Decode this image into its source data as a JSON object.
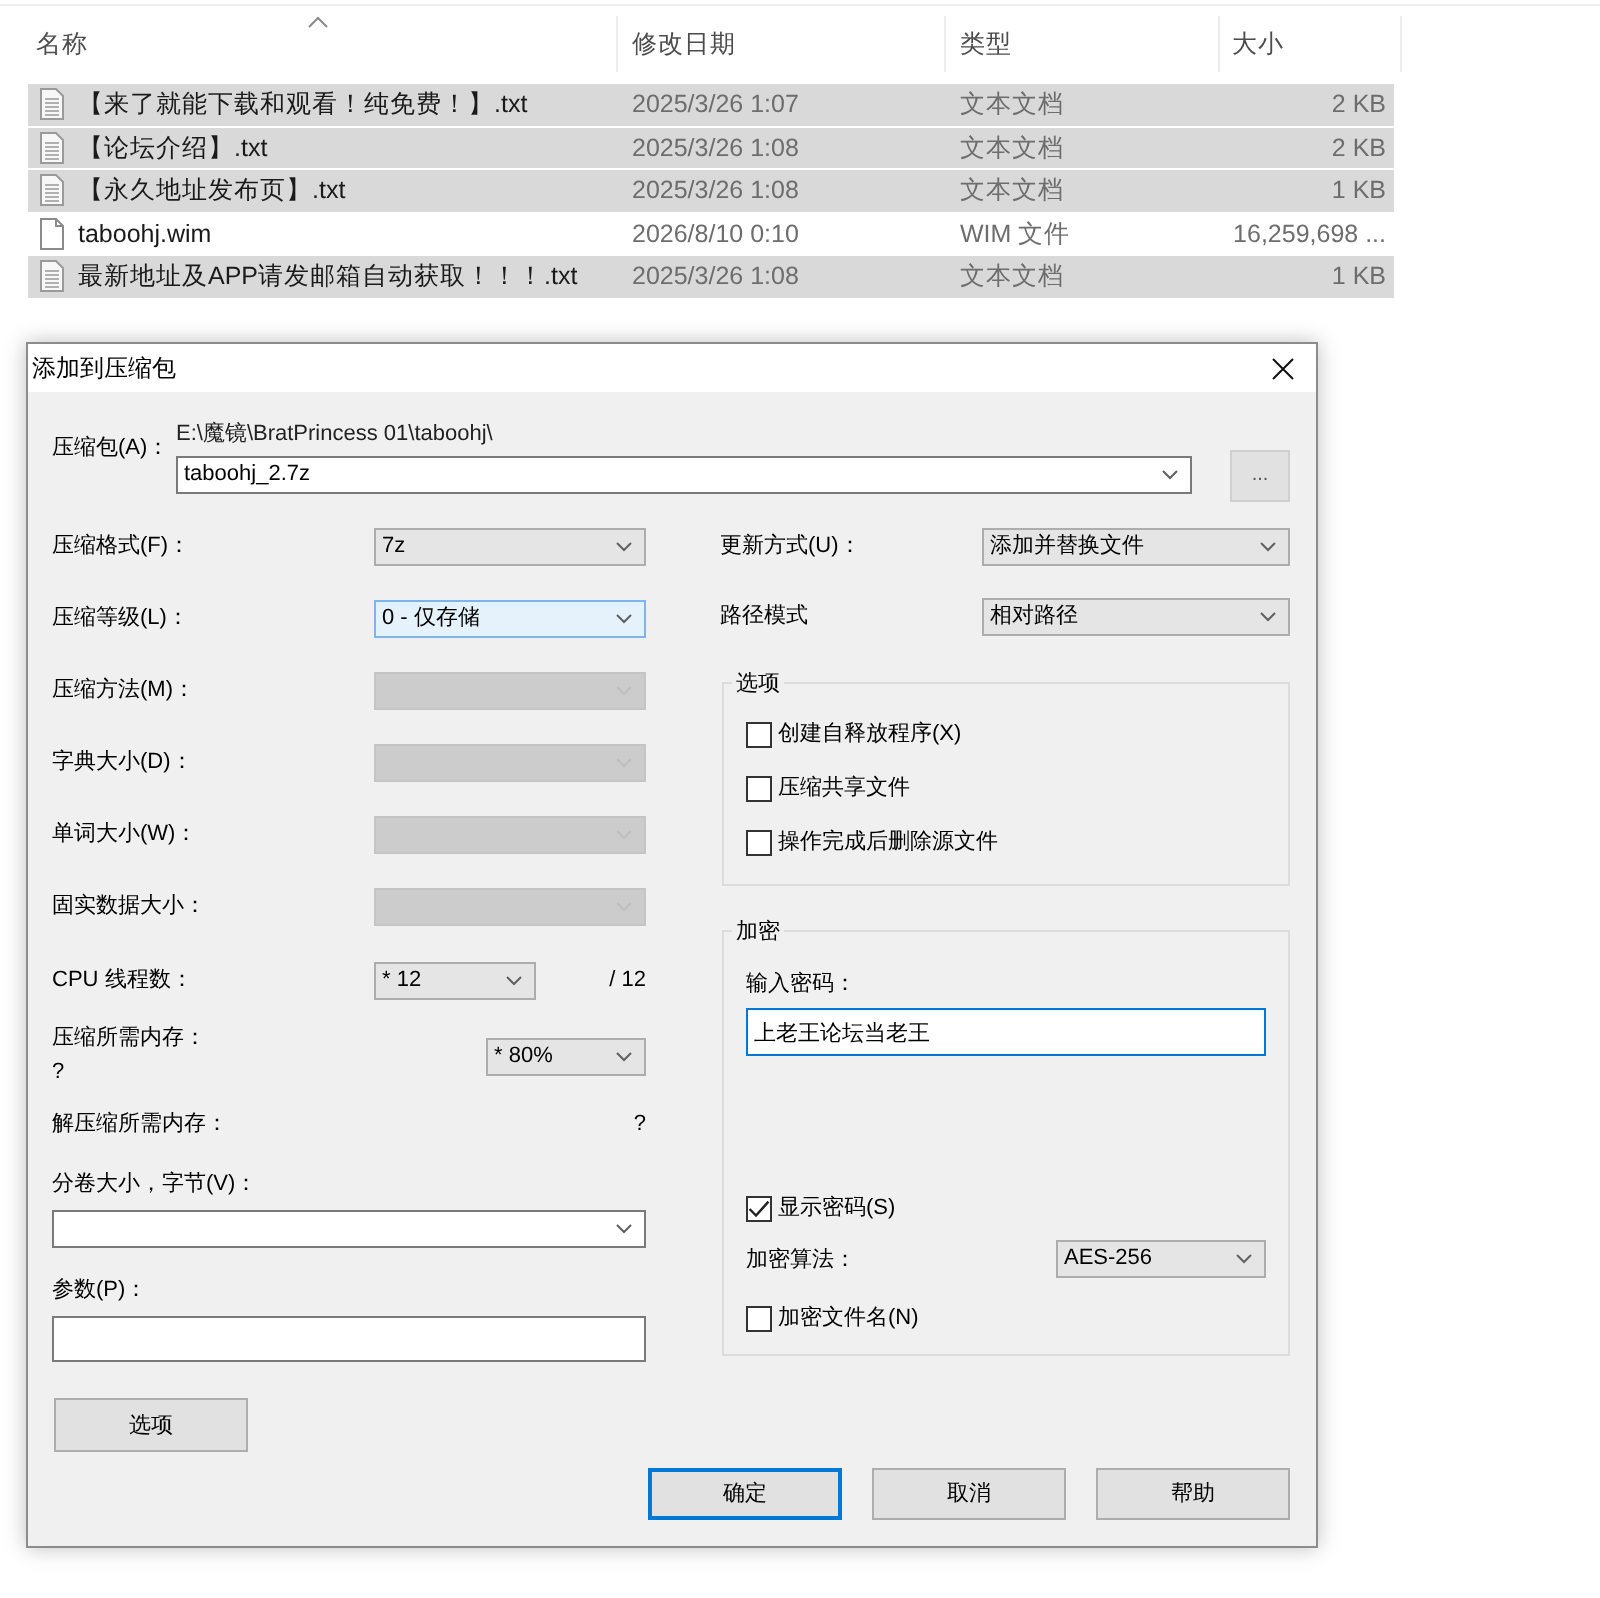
{
  "explorer": {
    "columns": [
      {
        "label": "名称",
        "sorted": true
      },
      {
        "label": "修改日期",
        "sorted": false
      },
      {
        "label": "类型",
        "sorted": false
      },
      {
        "label": "大小",
        "sorted": false
      }
    ],
    "files": [
      {
        "name": "【来了就能下载和观看！纯免费！】.txt",
        "modified": "2025/3/26 1:07",
        "type": "文本文档",
        "size": "2 KB",
        "kind": "text",
        "selected": true
      },
      {
        "name": "【论坛介绍】.txt",
        "modified": "2025/3/26 1:08",
        "type": "文本文档",
        "size": "2 KB",
        "kind": "text",
        "selected": true
      },
      {
        "name": "【永久地址发布页】.txt",
        "modified": "2025/3/26 1:08",
        "type": "文本文档",
        "size": "1 KB",
        "kind": "text",
        "selected": true
      },
      {
        "name": "taboohj.wim",
        "modified": "2026/8/10 0:10",
        "type": "WIM 文件",
        "size": "16,259,698 ...",
        "kind": "blank",
        "selected": false
      },
      {
        "name": "最新地址及APP请发邮箱自动获取！！！.txt",
        "modified": "2025/3/26 1:08",
        "type": "文本文档",
        "size": "1 KB",
        "kind": "text",
        "selected": true
      }
    ]
  },
  "dialog": {
    "title": "添加到压缩包",
    "archive": {
      "label": "压缩包(A)：",
      "path": "E:\\魔镜\\BratPrincess 01\\taboohj\\",
      "value": "taboohj_2.7z",
      "browse": "..."
    },
    "combos": [
      {
        "label": "压缩格式(F)：",
        "value": "7z",
        "disabled": false,
        "hovered": false
      },
      {
        "label": "压缩等级(L)：",
        "value": "0 - 仅存储",
        "disabled": false,
        "hovered": true
      },
      {
        "label": "压缩方法(M)：",
        "disabled": true,
        "hovered": false
      },
      {
        "label": "字典大小(D)：",
        "disabled": true,
        "hovered": false
      },
      {
        "label": "单词大小(W)：",
        "disabled": true,
        "hovered": false
      },
      {
        "label": "固实数据大小：",
        "disabled": true,
        "hovered": false
      }
    ],
    "threads": {
      "label": "CPU 线程数：",
      "value": "* 12",
      "total": "/ 12"
    },
    "memory": {
      "label": "压缩所需内存：",
      "value": "?",
      "limit": "* 80%"
    },
    "decompress_memory": {
      "label": "解压缩所需内存：",
      "value": "?"
    },
    "volume": {
      "label": "分卷大小，字节(V)："
    },
    "parameters": {
      "label": "参数(P)："
    },
    "options_button": "选项",
    "update_mode": {
      "label": "更新方式(U)：",
      "value": "添加并替换文件"
    },
    "path_mode": {
      "label": "路径模式",
      "value": "相对路径"
    },
    "options": {
      "title": "选项",
      "checkboxes": [
        {
          "label": "创建自释放程序(X)",
          "checked": false
        },
        {
          "label": "压缩共享文件",
          "checked": false
        },
        {
          "label": "操作完成后删除源文件",
          "checked": false
        }
      ]
    },
    "encryption": {
      "title": "加密",
      "password": {
        "label": "输入密码：",
        "value": "上老王论坛当老王",
        "focused": true
      },
      "show_password": {
        "label": "显示密码(S)",
        "checked": true
      },
      "method": {
        "label": "加密算法：",
        "value": "AES-256"
      },
      "encrypt_names": {
        "label": "加密文件名(N)",
        "checked": false
      }
    },
    "buttons": [
      {
        "label": "确定",
        "default": true
      },
      {
        "label": "取消",
        "default": false
      },
      {
        "label": "帮助",
        "default": false
      }
    ]
  }
}
